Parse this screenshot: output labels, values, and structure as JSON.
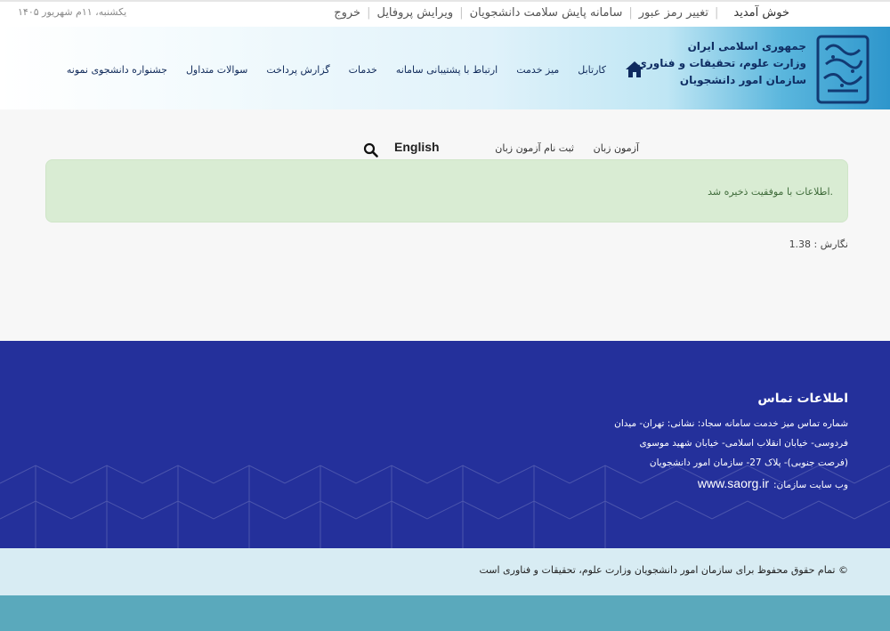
{
  "topbar": {
    "date": "یکشنبه، ۱۱م شهریور ۱۴۰۵",
    "welcome": "خوش آمدید",
    "links": [
      "تغییر رمز عبور",
      "سامانه پایش سلامت دانشجویان",
      "ویرایش پروفایل",
      "خروج"
    ]
  },
  "logo": {
    "line1": "جمهوری اسلامی ایران",
    "line2": "وزارت علوم، تحقیقات و فناوری",
    "line3": "سازمان امور دانشجویان"
  },
  "nav": {
    "home_icon": "home-icon",
    "items": [
      "کارتابل",
      "میز خدمت",
      "ارتباط با پشتیبانی سامانه",
      "خدمات",
      "گزارش پرداخت",
      "سوالات متداول",
      "جشنواره دانشجوی نمونه"
    ]
  },
  "subnav": {
    "exam": "آزمون زبان",
    "register": "ثبت نام آزمون زبان",
    "english": "English",
    "search_icon": "search-icon"
  },
  "alert": {
    "message": ".اطلاعات با موفقیت ذخیره شد"
  },
  "version": "نگارش : 1.38",
  "footer": {
    "title": "اطلاعات تماس",
    "line1": "شماره تماس میز خدمت سامانه سجاد: نشانی: تهران- میدان",
    "line2": "فردوسی- خیابان انقلاب اسلامی- خیابان شهید موسوی",
    "line3": "(فرصت جنوبی)- پلاک 27- سازمان امور دانشجویان",
    "site_label": "وب سایت سازمان:",
    "site_url": "www.saorg.ir"
  },
  "copyright": "© تمام حقوق محفوظ برای سازمان امور دانشجویان وزارت علوم، تحقیقات و فناوری است",
  "colors": {
    "header_dark": "#2e96cc",
    "nav_text": "#102a5a",
    "alert_bg": "#d9ecd3",
    "footer_bg": "#24309b",
    "copyright_bg": "#d8ecf3",
    "bottom_bar": "#5aa9bc"
  }
}
